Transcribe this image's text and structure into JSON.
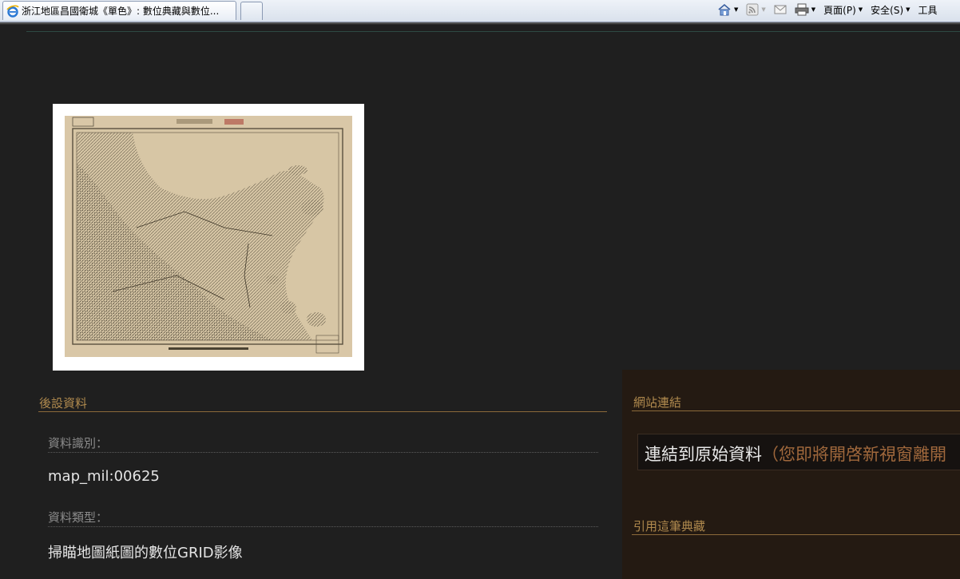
{
  "browser": {
    "tab_title": "浙江地區昌國衛城《單色》: 數位典藏與數位...",
    "toolbar": {
      "page_label": "頁面(P)",
      "safety_label": "安全(S)",
      "tools_label": "工具"
    }
  },
  "metadata": {
    "section_title": "後設資料",
    "fields": [
      {
        "label": "資料識別：",
        "value": "map_mil:00625"
      },
      {
        "label": "資料類型：",
        "value": "掃瞄地圖紙圖的數位GRID影像"
      }
    ]
  },
  "sidebar": {
    "links_title": "網站連結",
    "link_main": "連結到原始資料",
    "link_note": "（您即將開啓新視窗離開",
    "cite_title": "引用這筆典藏"
  }
}
